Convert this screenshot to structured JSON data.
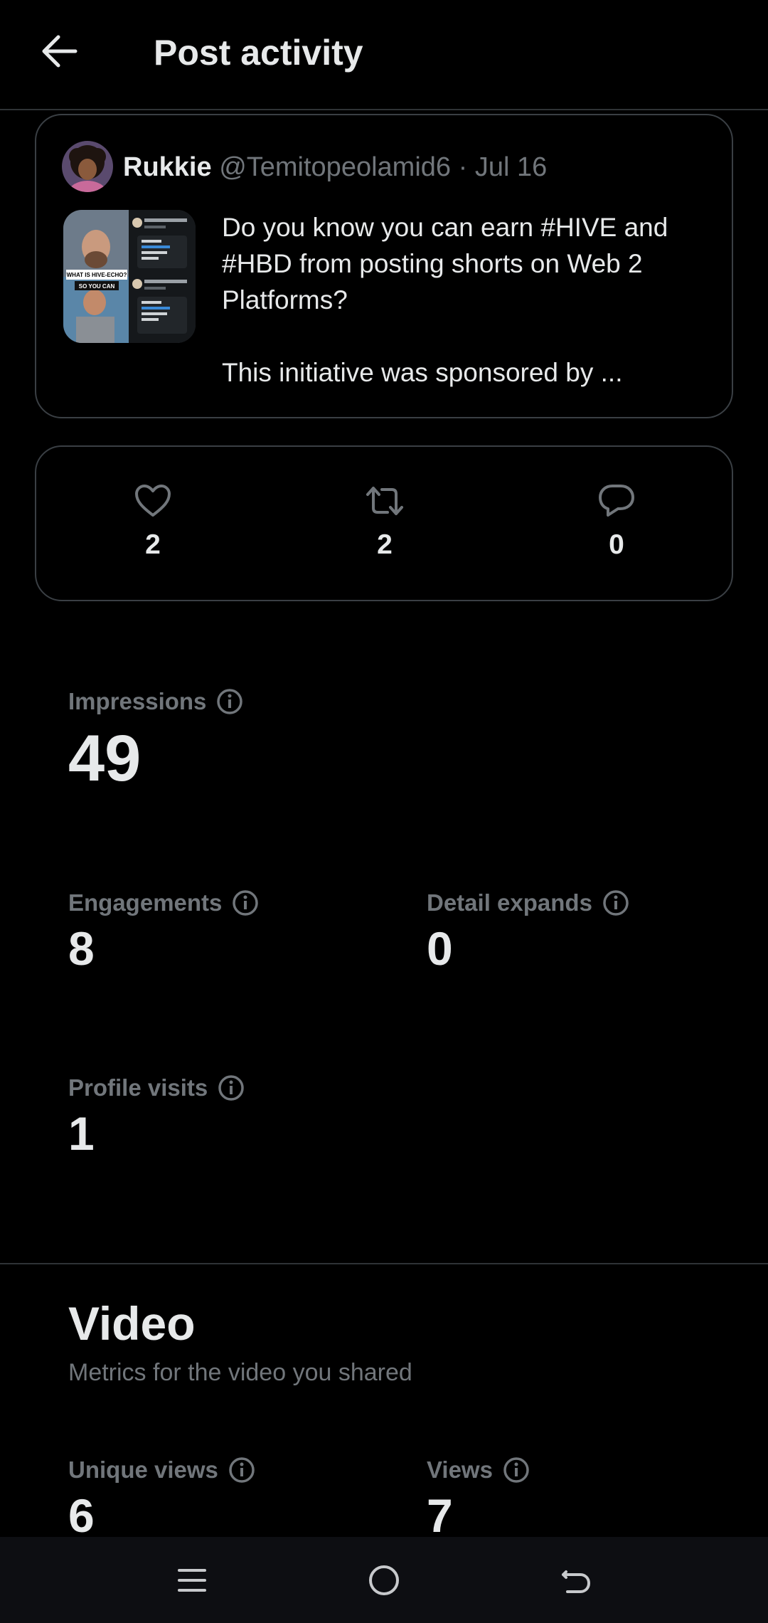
{
  "header": {
    "title": "Post activity",
    "back_icon": "arrow-left-icon"
  },
  "post": {
    "author_name": "Rukkie",
    "author_handle": "@Temitopeolamid6",
    "separator": "·",
    "date": "Jul 16",
    "text_line1": "Do you know you can earn #HIVE and #HBD from posting shorts on Web 2 Platforms?",
    "text_line2": "This initiative was sponsored by ...",
    "thumbnail_caption_1": "WHAT IS HIVE-ECHO?",
    "thumbnail_caption_2": "SO YOU CAN"
  },
  "engagement": {
    "likes": "2",
    "reposts": "2",
    "replies": "0"
  },
  "metrics": {
    "impressions_label": "Impressions",
    "impressions_value": "49",
    "engagements_label": "Engagements",
    "engagements_value": "8",
    "detail_expands_label": "Detail expands",
    "detail_expands_value": "0",
    "profile_visits_label": "Profile visits",
    "profile_visits_value": "1"
  },
  "video": {
    "title": "Video",
    "subtitle": "Metrics for the video you shared",
    "unique_views_label": "Unique views",
    "unique_views_value": "6",
    "views_label": "Views",
    "views_value": "7"
  },
  "colors": {
    "background": "#000000",
    "text_primary": "#e7e9ea",
    "text_secondary": "#71767b",
    "border": "#3a3f44",
    "navbar": "#0d0e12"
  }
}
